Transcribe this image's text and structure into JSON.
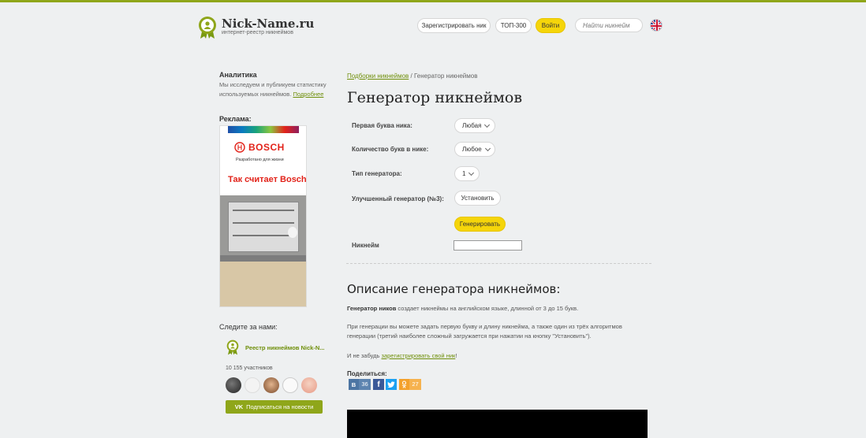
{
  "header": {
    "logo_title": "Nick-Name.ru",
    "logo_subtitle": "интернет-реестр никнеймов",
    "register_label": "Зарегистрировать ник",
    "top300_label": "ТОП-300",
    "login_label": "Войти",
    "search_placeholder": "Найти никнейм",
    "lang_icon": "uk-flag-icon"
  },
  "sidebar": {
    "analytics_title": "Аналитика",
    "analytics_text": "Мы исследуем и публикуем статистику используемых никнеймов.",
    "analytics_link": "Подробнее",
    "ad_label": "Реклама:",
    "ad": {
      "brand": "BOSCH",
      "tagline": "Разработано для жизни",
      "headline": "Так считает Bosch."
    },
    "follow_label": "Следите за нами:",
    "group_name": "Реестр никнеймов Nick-N...",
    "members": "10 155 участников",
    "subscribe_label": "Подписаться на новости"
  },
  "breadcrumb": {
    "link": "Подборки никнеймов",
    "separator": "/",
    "current": "Генератор никнеймов"
  },
  "page_title": "Генератор никнеймов",
  "form": {
    "first_letter_label": "Первая буква ника:",
    "first_letter_value": "Любая",
    "letters_count_label": "Количество букв в нике:",
    "letters_count_value": "Любое",
    "generator_type_label": "Тип генератора:",
    "generator_type_value": "1",
    "advanced_label": "Улучшенный генератор (№3):",
    "install_label": "Установить",
    "generate_label": "Генерировать",
    "nickname_label": "Никнейм",
    "nickname_value": ""
  },
  "description": {
    "title": "Описание генератора никнеймов:",
    "p1_bold": "Генератор ников",
    "p1_rest": "создает никнеймы на английском языке, длинной от 3 до 15 букв.",
    "p2": "При генерации вы можете задать первую букву и длину никнейма, а также один из трёх алгоритмов генерации (третий наиболее сложный загружается при нажатии на кнопку \"Установить\").",
    "p3_prefix": "И не забудь",
    "p3_link": "зарегистрировать свой ник",
    "p3_suffix": "!"
  },
  "share": {
    "label": "Поделиться:",
    "vk_icon": "В",
    "vk_count": "36",
    "fb_icon": "f",
    "ok_count": "27"
  },
  "colors": {
    "accent_green": "#8fa61a",
    "link_green": "#6f8f0a",
    "button_yellow": "#f5d50a",
    "background": "#eef0f1"
  }
}
